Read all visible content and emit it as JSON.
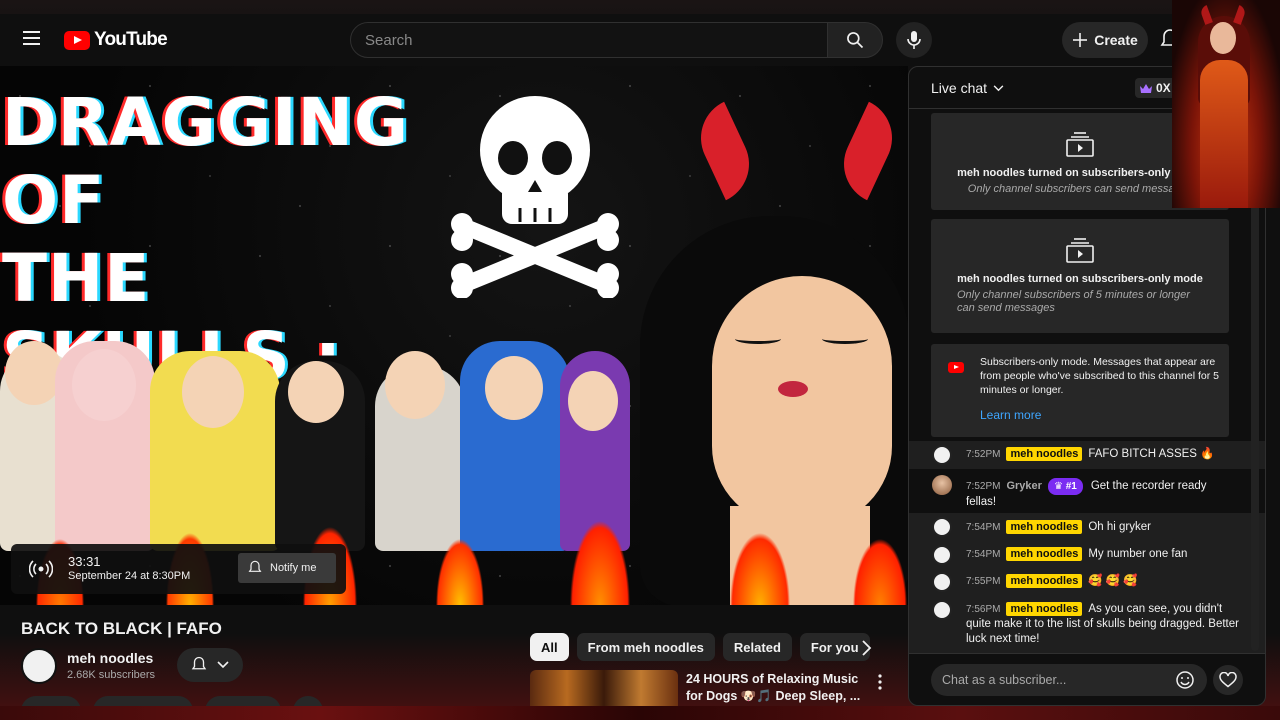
{
  "header": {
    "logo_text": "YouTube",
    "search_placeholder": "Search",
    "create_label": "Create"
  },
  "video": {
    "thumbnail_title": "DRAGGING OF\nTHE SKULLS :\nFAFO EDITION",
    "duration": "33:31",
    "scheduled": "September 24 at 8:30PM",
    "notify_label": "Notify me"
  },
  "watch": {
    "title": "BACK TO BLACK | FAFO",
    "channel_name": "meh noodles",
    "subscribers": "2.68K subscribers"
  },
  "related": {
    "chips": [
      {
        "label": "All",
        "active": true
      },
      {
        "label": "From meh noodles",
        "active": false
      },
      {
        "label": "Related",
        "active": false
      },
      {
        "label": "For you",
        "active": false
      }
    ],
    "first_title": "24 HOURS of Relaxing Music for Dogs 🐶🎵 Deep Sleep, ..."
  },
  "chat": {
    "header_title": "Live chat",
    "points": "0X",
    "notices": [
      {
        "main": "meh noodles turned on subscribers-only mode",
        "sub": "Only channel subscribers can send messages"
      },
      {
        "main": "meh noodles turned on subscribers-only mode",
        "sub": "Only channel subscribers of 5 minutes or longer can send messages"
      }
    ],
    "info_text": "Subscribers-only mode. Messages that appear are from people who've subscribed to this channel for 5 minutes or longer.",
    "learn_more": "Learn more",
    "messages": [
      {
        "time": "7:52PM",
        "author": "meh noodles",
        "owner": true,
        "text": "FAFO BITCH ASSES 🔥"
      },
      {
        "time": "7:52PM",
        "author": "Gryker",
        "owner": false,
        "rank": "#1",
        "text": "Get the recorder ready fellas!"
      },
      {
        "time": "7:54PM",
        "author": "meh noodles",
        "owner": true,
        "text": "Oh hi gryker"
      },
      {
        "time": "7:54PM",
        "author": "meh noodles",
        "owner": true,
        "text": "My number one fan"
      },
      {
        "time": "7:55PM",
        "author": "meh noodles",
        "owner": true,
        "text": "🥰 🥰 🥰"
      },
      {
        "time": "7:56PM",
        "author": "meh noodles",
        "owner": true,
        "text": "As you can see, you didn't quite make it to the list of skulls being dragged. Better luck next time!"
      }
    ],
    "input_placeholder": "Chat as a subscriber..."
  },
  "colors": {
    "accent_red": "#ff0000",
    "owner_badge": "#ffd600",
    "rank_badge": "#7b2cf2",
    "link": "#3ea6ff"
  },
  "icons": [
    "menu-icon",
    "youtube-logo-icon",
    "search-icon",
    "mic-icon",
    "plus-icon",
    "bell-icon",
    "live-broadcast-icon",
    "chevron-down-icon",
    "crown-icon",
    "subscribers-only-icon",
    "youtube-icon",
    "emoji-icon",
    "heart-icon",
    "chevron-right-icon",
    "more-vert-icon"
  ]
}
